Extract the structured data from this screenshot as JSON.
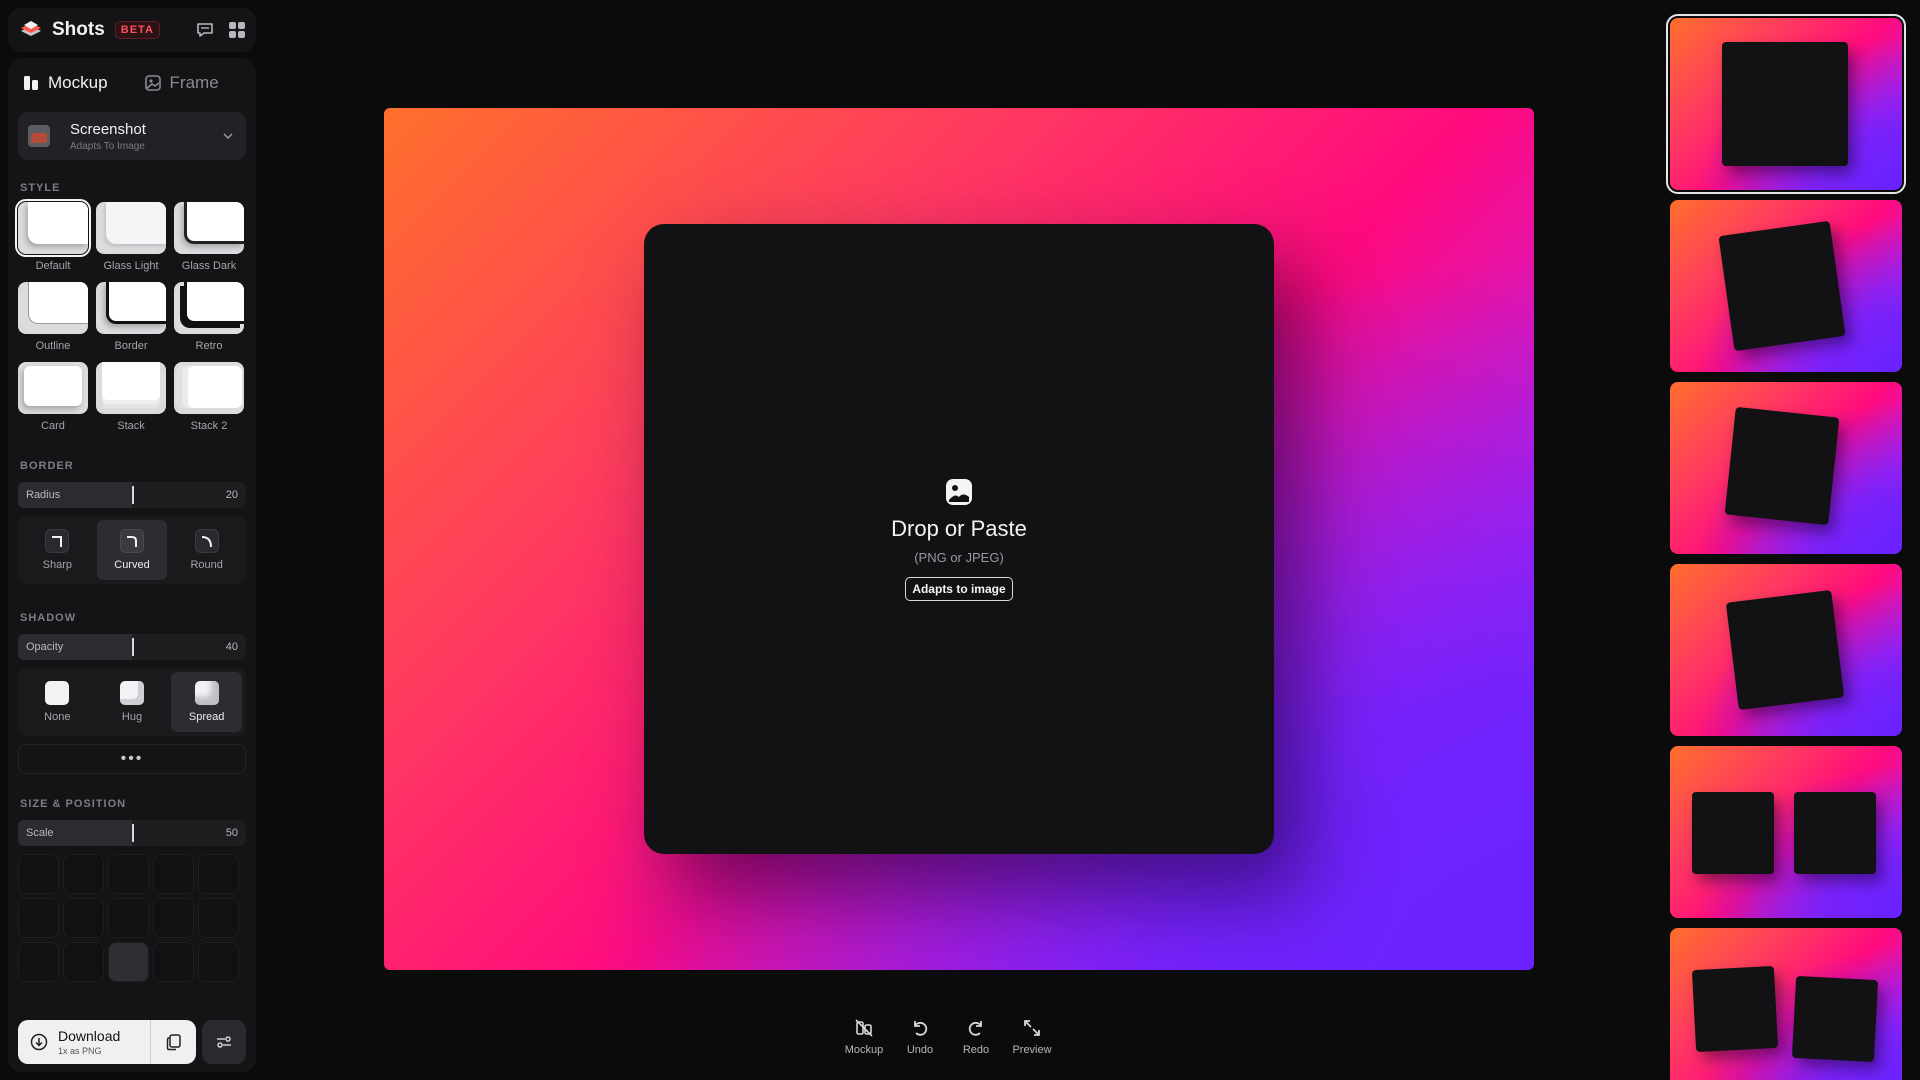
{
  "app": {
    "name": "Shots",
    "badge": "BETA"
  },
  "tabs": [
    {
      "label": "Mockup"
    },
    {
      "label": "Frame"
    }
  ],
  "mockup_select": {
    "title": "Screenshot",
    "subtitle": "Adapts To Image"
  },
  "style": {
    "section": "STYLE",
    "items": [
      {
        "label": "Default"
      },
      {
        "label": "Glass Light"
      },
      {
        "label": "Glass Dark"
      },
      {
        "label": "Outline"
      },
      {
        "label": "Border"
      },
      {
        "label": "Retro"
      },
      {
        "label": "Card"
      },
      {
        "label": "Stack"
      },
      {
        "label": "Stack 2"
      }
    ],
    "selected": "Default"
  },
  "border": {
    "section": "BORDER",
    "radius_label": "Radius",
    "radius_value": "20",
    "options": [
      {
        "label": "Sharp"
      },
      {
        "label": "Curved"
      },
      {
        "label": "Round"
      }
    ],
    "selected": "Curved"
  },
  "shadow": {
    "section": "SHADOW",
    "opacity_label": "Opacity",
    "opacity_value": "40",
    "options": [
      {
        "label": "None"
      },
      {
        "label": "Hug"
      },
      {
        "label": "Spread"
      }
    ],
    "selected": "Spread",
    "more": "•••"
  },
  "size_position": {
    "section": "SIZE & POSITION",
    "scale_label": "Scale",
    "scale_value": "50"
  },
  "download": {
    "title": "Download",
    "subtitle": "1x as PNG"
  },
  "canvas": {
    "drop_title": "Drop or Paste",
    "drop_sub": "(PNG or JPEG)",
    "adapt_button": "Adapts to image"
  },
  "toolbar": [
    {
      "label": "Mockup"
    },
    {
      "label": "Undo"
    },
    {
      "label": "Redo"
    },
    {
      "label": "Preview"
    }
  ],
  "colors": {
    "gradient": [
      "#ff6f2c",
      "#ff0a7e",
      "#7b2bff"
    ],
    "panel": "#141416",
    "background": "#0b0b0c",
    "badge": "#ff4d5e"
  }
}
